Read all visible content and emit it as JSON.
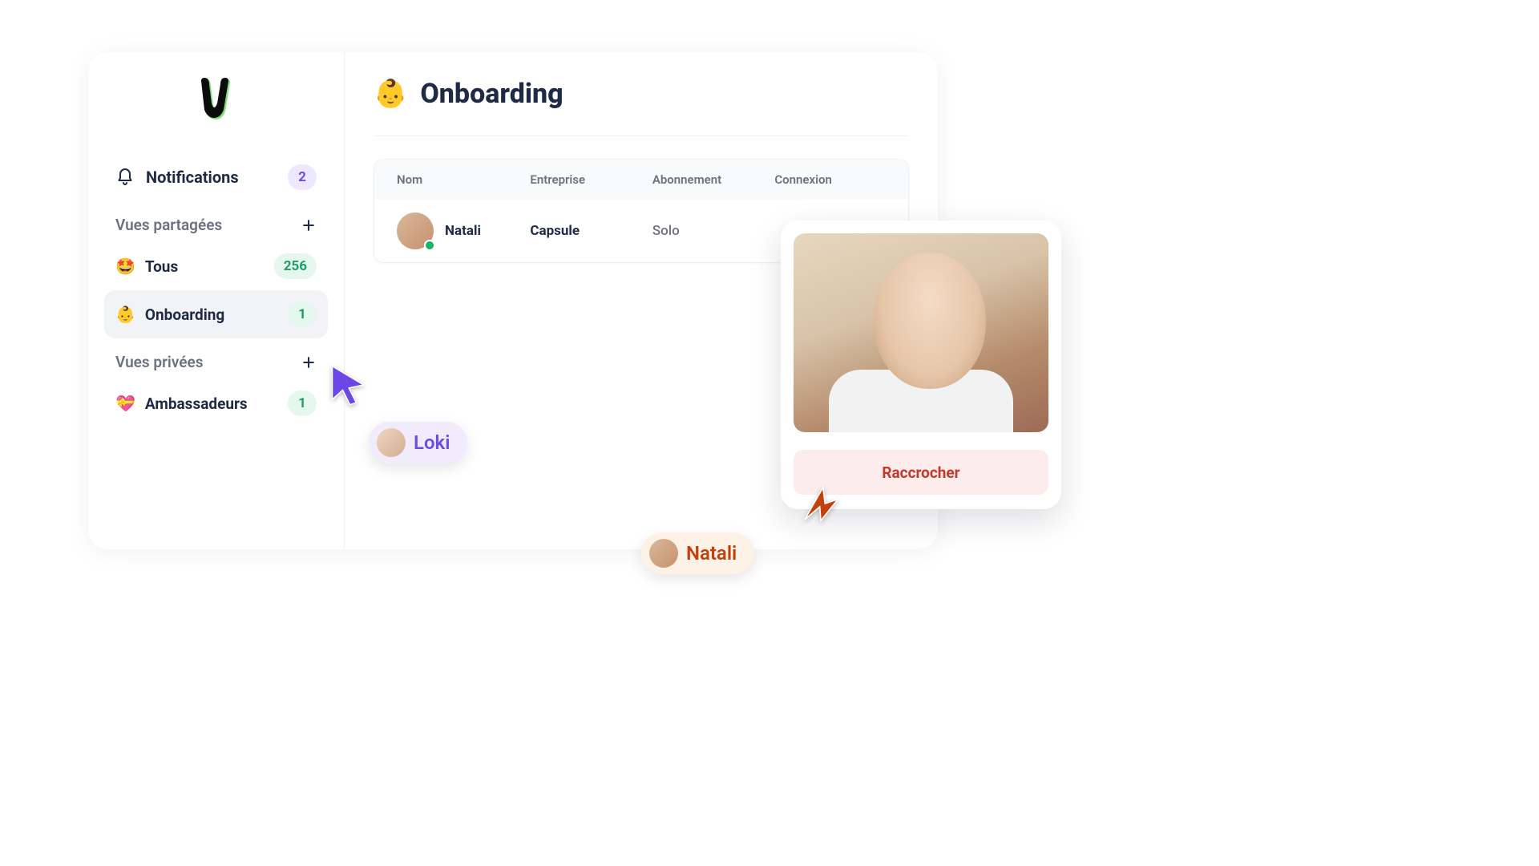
{
  "sidebar": {
    "notifications": {
      "label": "Notifications",
      "count": "2"
    },
    "shared": {
      "header": "Vues partagées",
      "items": [
        {
          "emoji": "🤩",
          "label": "Tous",
          "count": "256"
        },
        {
          "emoji": "👶",
          "label": "Onboarding",
          "count": "1",
          "active": true
        }
      ]
    },
    "private": {
      "header": "Vues privées",
      "items": [
        {
          "emoji": "💝",
          "label": "Ambassadeurs",
          "count": "1"
        }
      ]
    }
  },
  "page": {
    "title_emoji": "👶",
    "title": "Onboarding"
  },
  "table": {
    "columns": {
      "name": "Nom",
      "company": "Entreprise",
      "plan": "Abonnement",
      "login": "Connexion"
    },
    "rows": [
      {
        "name": "Natali",
        "company": "Capsule",
        "plan": "Solo",
        "login": ""
      }
    ]
  },
  "cursors": {
    "loki": "Loki",
    "natali": "Natali"
  },
  "call": {
    "hangup": "Raccrocher"
  },
  "colors": {
    "purple": "#6b4ee6",
    "orange": "#c2410c",
    "green": "#12b76a"
  }
}
